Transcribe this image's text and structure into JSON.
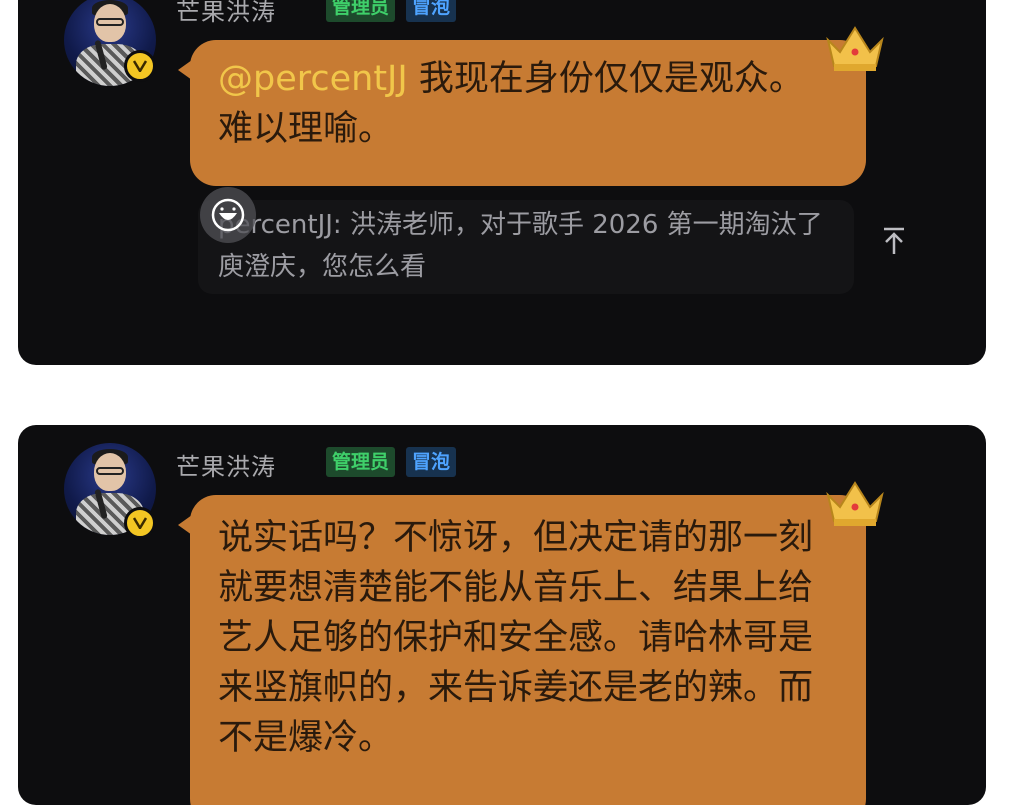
{
  "post1": {
    "username": "芒果洪涛",
    "tags": [
      "管理员",
      "冒泡"
    ],
    "mention": "@percentJJ",
    "message": " 我现在身份仅仅是观众。难以理喻。",
    "quote_text": "percentJJ: 洪涛老师，对于歌手 2026 第一期淘汰了庾澄庆，您怎么看"
  },
  "post2": {
    "username": "芒果洪涛",
    "tags": [
      "管理员",
      "冒泡"
    ],
    "message": "说实话吗？不惊讶，但决定请的那一刻就要想清楚能不能从音乐上、结果上给艺人足够的保护和安全感。请哈林哥是来竖旗帜的，来告诉姜还是老的辣。而不是爆冷。"
  },
  "colors": {
    "card_bg": "#0d0d0f",
    "bubble_bg": "#c77b33",
    "mention": "#f1c64a",
    "admin_tag_text": "#3fd06a",
    "bubble_tag_text": "#4ea3ff",
    "verified_badge": "#f3c623"
  },
  "icons": [
    "verified-badge-icon",
    "crown-icon",
    "emoji-icon",
    "arrow-up-icon"
  ]
}
